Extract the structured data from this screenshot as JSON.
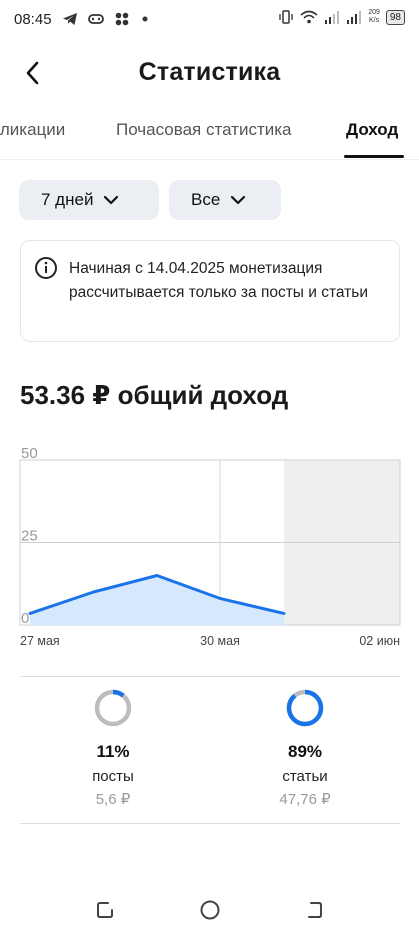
{
  "status_bar": {
    "time": "08:45",
    "net_speed_value": "209",
    "net_speed_unit": "K/s",
    "battery": "98",
    "icons_left": [
      "telegram-icon",
      "gamepad-icon",
      "apps-icon",
      "dot-icon"
    ],
    "icons_right": [
      "vibrate-icon",
      "wifi-icon",
      "signal-icon",
      "signal-icon"
    ]
  },
  "header": {
    "title": "Статистика",
    "back_icon": "chevron-left-icon"
  },
  "tabs": [
    {
      "label": "Публикации"
    },
    {
      "label": "Почасовая статистика"
    },
    {
      "label": "Доход",
      "active": true
    }
  ],
  "filters": {
    "period": "7 дней",
    "type": "Все"
  },
  "info": {
    "icon": "info-icon",
    "text": "Начиная с 14.04.2025 монетизация рассчитывается только за посты и статьи"
  },
  "income": {
    "text": "53.36 ₽ общий доход"
  },
  "chart_data": {
    "type": "area",
    "x": [
      "27 мая",
      "28 мая",
      "29 мая",
      "30 мая",
      "31 мая"
    ],
    "values": [
      3.5,
      10,
      15,
      8,
      3.5
    ],
    "x_tick_labels": [
      "27 мая",
      "30 мая",
      "02 июн"
    ],
    "y_tick_labels": [
      "0",
      "25",
      "50"
    ],
    "ylim": [
      0,
      50
    ],
    "line_color": "#1a73e8",
    "fill_color": "#d6e8fb",
    "grid": true
  },
  "stats": [
    {
      "percent": "11%",
      "fraction": 0.11,
      "label": "посты",
      "amount": "5,6 ₽"
    },
    {
      "percent": "89%",
      "fraction": 0.89,
      "label": "статьи",
      "amount": "47,76 ₽"
    }
  ],
  "colors": {
    "accent": "#1a73e8",
    "ring_track": "#bdbdbd",
    "filter_bg": "#ebeef3"
  },
  "nav_bar": {
    "icons": [
      "recents-icon",
      "home-icon",
      "back-nav-icon"
    ]
  }
}
